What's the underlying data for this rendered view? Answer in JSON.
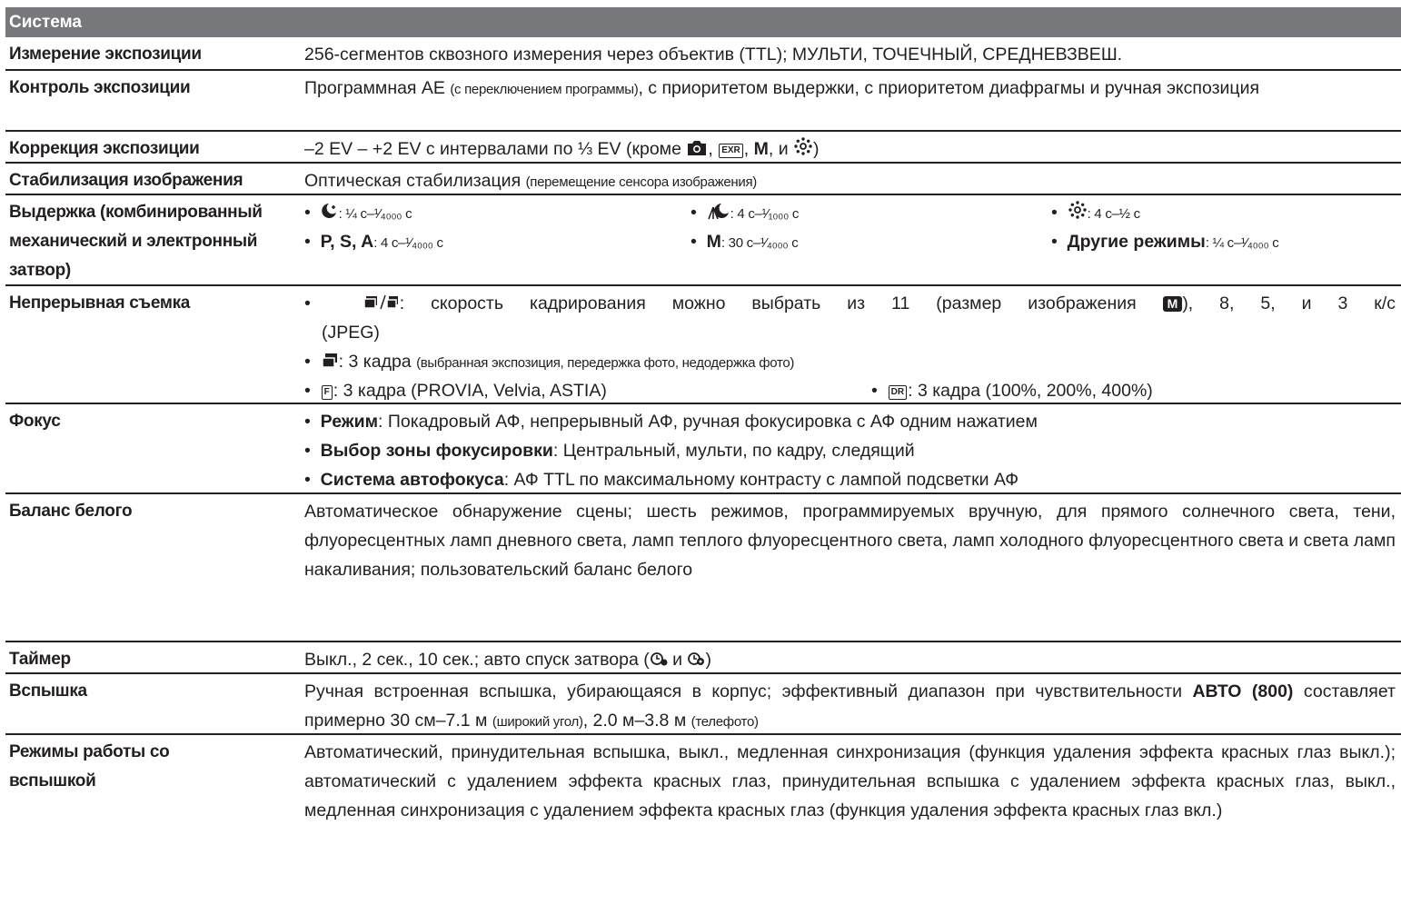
{
  "section_title": "Система",
  "rows": {
    "metering": {
      "label": "Измерение экспозиции",
      "value": "256-сегментов сквозного измерения через объектив (TTL); МУЛЬТИ, ТОЧЕЧНЫЙ, СРЕДНЕВЗВЕШ."
    },
    "exposure_control": {
      "label": "Контроль экспозиции",
      "value_a": "Программная АЕ ",
      "value_small": "(с переключением программы)",
      "value_b": ", с приоритетом выдержки, с приоритетом диафрагмы и ручная экспозиция"
    },
    "exposure_comp": {
      "label": "Коррекция экспозиции",
      "value_a": "–2 EV – +2 EV с интервалами по ⅓ EV (кроме",
      "m": "M",
      "value_c": ", и",
      "value_d": ")"
    },
    "stabilization": {
      "label": "Стабилизация изображения",
      "value": "Оптическая стабилизация ",
      "value_small": "(перемещение сенсора изображения)"
    },
    "shutter": {
      "label_line1": "Выдержка (комбинированный",
      "label_line2": "механический и электронный",
      "label_line3": "затвор)",
      "item1": ": ¼ с–¹⁄₄₀₀₀ с",
      "item2": ": 4 с–¹⁄₁₀₀₀ с",
      "item3": ": 4 с–½ с",
      "item4_modes": "P, S, A",
      "item4": ": 4 с–¹⁄₄₀₀₀ с",
      "item5_mode": "M",
      "item5": ": 30 с–¹⁄₄₀₀₀ с",
      "item6_label": "Другие режимы",
      "item6": ": ¼ с–¹⁄₄₀₀₀ с"
    },
    "continuous": {
      "label": "Непрерывная съемка",
      "line1": ": скорость кадрирования можно выбрать из 11 (размер изображения",
      "size_badge": "M",
      "line1b": "), 8, 5, и 3 к/с",
      "line2": "(JPEG)",
      "line3": ": 3 кадра ",
      "line3_small": "(выбранная экспозиция, передержка фото, недодержка фото)",
      "line4a": ": 3 кадра (PROVIA, Velvia, ASTIA)",
      "line4b_badge": "DR",
      "line4b": ": 3 кадра (100%, 200%, 400%)"
    },
    "focus": {
      "label": "Фокус",
      "mode_label": "Режим",
      "mode": ": Покадровый АФ, непрерывный АФ, ручная фокусировка с АФ одним нажатием",
      "area_label": "Выбор зоны фокусировки",
      "area": ": Центральный, мульти, по кадру, следящий",
      "af_label": "Система автофокуса",
      "af": ": АФ TTL по максимальному контрасту с лампой подсветки АФ"
    },
    "white_balance": {
      "label": "Баланс белого",
      "value": "Автоматическое обнаружение сцены; шесть режимов, программируемых вручную, для прямого солнечного света, тени, флуоресцентных ламп дневного света, ламп теплого флуоресцентного света, ламп холодного флуоресцентного света и света ламп накаливания; пользовательский баланс белого"
    },
    "timer": {
      "label": "Таймер",
      "value_a": "Выкл., 2 сек., 10 сек.; авто спуск затвора (",
      "value_b": " и ",
      "value_c": ")"
    },
    "flash": {
      "label": "Вспышка",
      "value_a": "Ручная встроенная вспышка, убирающаяся в корпус; эффективный диапазон при чувствительности ",
      "value_bold": "АВТО (800)",
      "value_b": " составляет примерно 30 см–7.1 м ",
      "value_small1": "(широкий угол)",
      "value_c": ", 2.0 м–3.8 м ",
      "value_small2": "(телефото)"
    },
    "flash_modes": {
      "label_line1": "Режимы работы со",
      "label_line2": "вспышкой",
      "value": "Автоматический, принудительная вспышка, выкл., медленная синхронизация (функция удаления эффекта красных глаз выкл.); автоматический с удалением эффекта красных глаз, принудительная вспышка с удалением эффекта красных глаз, выкл., медленная синхронизация с удалением эффекта красных глаз (функция удаления эффекта красных глаз вкл.)"
    }
  },
  "icons": [
    "camera-icon",
    "exr-auto-icon",
    "scene-icon",
    "night-icon",
    "night-tripod-icon",
    "continuous-icon",
    "bracketing-icon",
    "film-simulation-icon",
    "dynamic-range-icon",
    "self-timer-icon"
  ]
}
